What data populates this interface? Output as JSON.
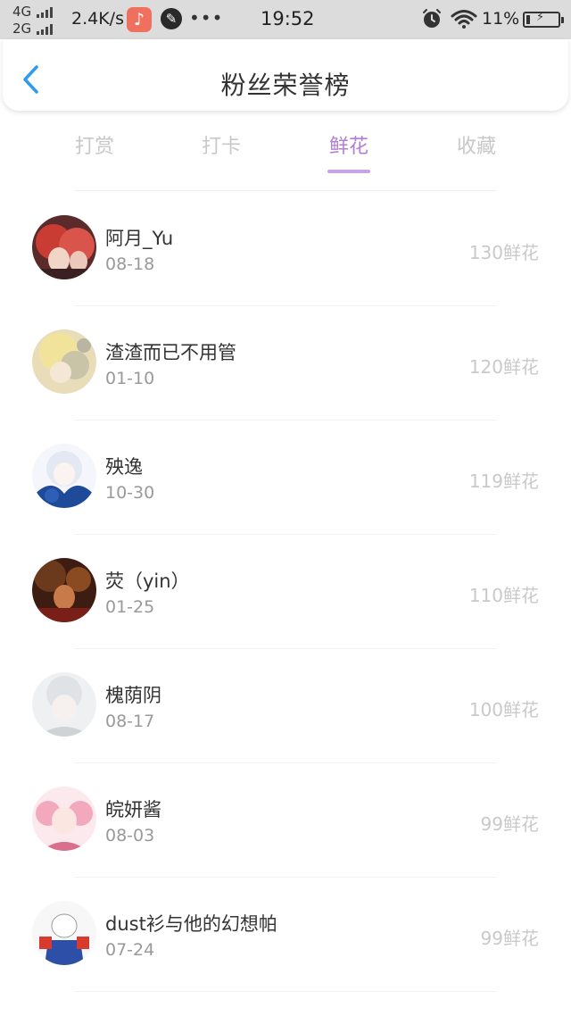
{
  "status_bar": {
    "net_top": "4G",
    "net_bottom": "2G",
    "speed": "2.4K/s",
    "dots": "•••",
    "time": "19:52",
    "battery_pct": "11%",
    "battery_level": 0.11
  },
  "header": {
    "title": "粉丝荣誉榜"
  },
  "tabs": [
    {
      "label": "打赏",
      "active": false
    },
    {
      "label": "打卡",
      "active": false
    },
    {
      "label": "鲜花",
      "active": true
    },
    {
      "label": "收藏",
      "active": false
    }
  ],
  "fans": [
    {
      "name": "阿月_Yu",
      "date": "08-18",
      "amount": "130鲜花"
    },
    {
      "name": "渣渣而已不用管",
      "date": "01-10",
      "amount": "120鲜花"
    },
    {
      "name": "殃逸",
      "date": "10-30",
      "amount": "119鲜花"
    },
    {
      "name": "荧（yin）",
      "date": "01-25",
      "amount": "110鲜花"
    },
    {
      "name": "槐荫阴",
      "date": "08-17",
      "amount": "100鲜花"
    },
    {
      "name": "皖妍酱",
      "date": "08-03",
      "amount": "99鲜花"
    },
    {
      "name": "dust衫与他的幻想帕",
      "date": "07-24",
      "amount": "99鲜花"
    }
  ],
  "colors": {
    "accent": "#b07fd4",
    "tab_underline": "#c7a4e3",
    "back_arrow": "#2f9bf0",
    "muted_text": "#c9c9c9"
  }
}
